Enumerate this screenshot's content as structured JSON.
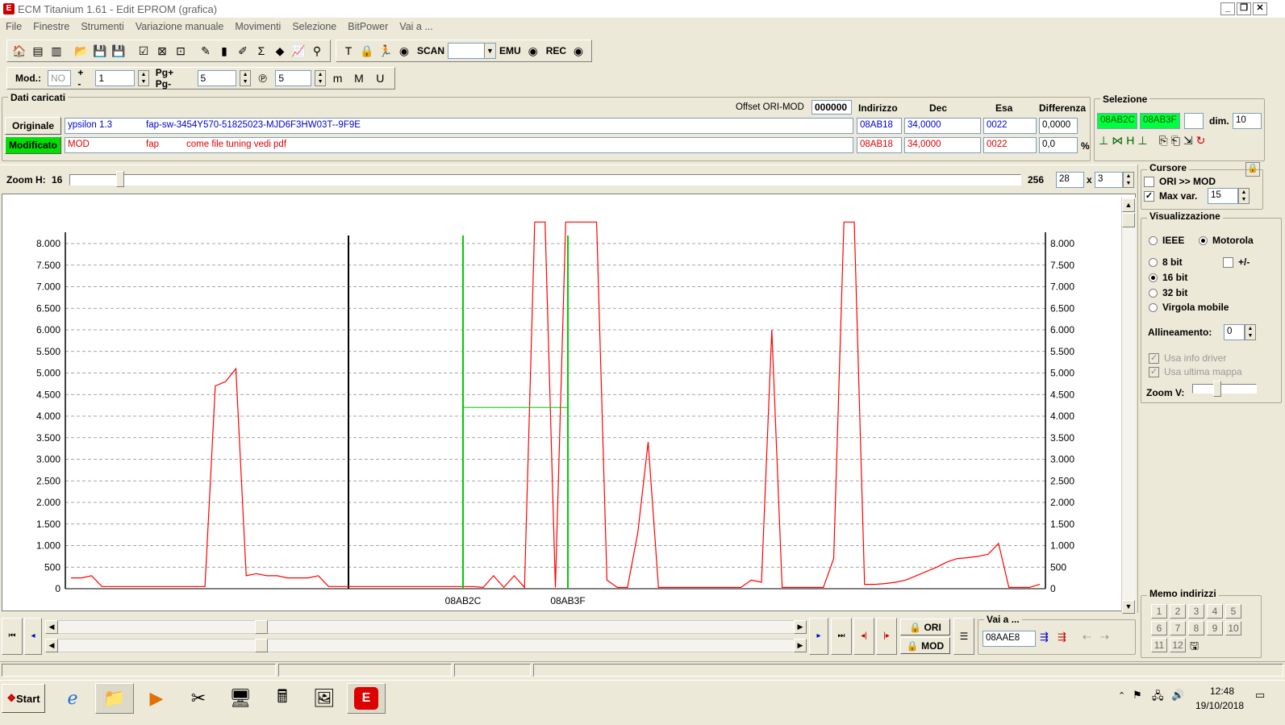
{
  "window": {
    "title": "ECM Titanium 1.61 - Edit EPROM (grafica)"
  },
  "menu": [
    "File",
    "Finestre",
    "Strumenti",
    "Variazione manuale",
    "Movimenti",
    "Selezione",
    "BitPower",
    "Vai a ..."
  ],
  "toolbar1": {
    "scan_label": "SCAN",
    "emu_label": "EMU",
    "rec_label": "REC"
  },
  "toolbar2": {
    "mod_label": "Mod.:",
    "mod_value": "NO",
    "plusminus_label": "+ -",
    "plusminus_value": "1",
    "pg_label": "Pg+ Pg-",
    "pg_value": "5",
    "p_value": "5"
  },
  "dati": {
    "title": "Dati caricati",
    "offset_label": "Offset ORI-MOD",
    "offset_value": "000000",
    "headers": {
      "indirizzo": "Indirizzo",
      "dec": "Dec",
      "esa": "Esa",
      "differenza": "Differenza"
    },
    "originale": {
      "button": "Originale",
      "name": "ypsilon 1.3",
      "desc": "fap-sw-3454Y570-51825023-MJD6F3HW03T--9F9E",
      "indirizzo": "08AB18",
      "dec": "34,0000",
      "esa": "0022",
      "differenza": "0,0000"
    },
    "modificato": {
      "button": "Modificato",
      "name": "MOD",
      "tag": "fap",
      "desc": "come file tuning vedi pdf",
      "indirizzo": "08AB18",
      "dec": "34,0000",
      "esa": "0022",
      "differenza": "0,0",
      "unit": "%"
    }
  },
  "selezione": {
    "title": "Selezione",
    "start": "08AB2C",
    "end": "08AB3F",
    "dim_label": "dim.",
    "dim_value": "10"
  },
  "zoom": {
    "label": "Zoom H:",
    "min": "16",
    "max": "256",
    "w": "28",
    "x": "x",
    "h": "3"
  },
  "cursore": {
    "title": "Cursore",
    "ori_mod": "ORI >> MOD",
    "maxvar": "Max var.",
    "maxvar_value": "15"
  },
  "visualizzazione": {
    "title": "Visualizzazione",
    "ieee": "IEEE",
    "motorola": "Motorola",
    "bit8": "8 bit",
    "plusminus": "+/-",
    "bit16": "16 bit",
    "bit32": "32 bit",
    "virgola": "Virgola mobile",
    "allineamento_label": "Allineamento:",
    "allineamento_value": "0",
    "usa_info": "Usa info driver",
    "usa_ultima": "Usa ultima mappa",
    "zoomv_label": "Zoom V:"
  },
  "memo": {
    "title": "Memo indirizzi",
    "buttons": [
      "1",
      "2",
      "3",
      "4",
      "5",
      "6",
      "7",
      "8",
      "9",
      "10",
      "11",
      "12"
    ]
  },
  "bottom": {
    "ori_label": "ORI",
    "mod_label": "MOD",
    "vai_label": "Vai a ...",
    "vai_value": "08AAE8"
  },
  "taskbar": {
    "start": "Start",
    "time": "12:48",
    "date": "19/10/2018"
  },
  "chart_data": {
    "type": "line",
    "ylim": [
      0,
      8000
    ],
    "yticks": [
      "0",
      "500",
      "1.000",
      "1.500",
      "2.000",
      "2.500",
      "3.000",
      "3.500",
      "4.000",
      "4.500",
      "5.000",
      "5.500",
      "6.000",
      "6.500",
      "7.000",
      "7.500",
      "8.000"
    ],
    "markers": [
      "08AB2C",
      "08AB3F"
    ],
    "colors": {
      "series": "#ff0000",
      "selection": "#00cc00",
      "boundary": "#000000",
      "grid": "#888888"
    },
    "series": [
      {
        "values": [
          250,
          250,
          300,
          50,
          50,
          50,
          50,
          50,
          50,
          50,
          50,
          50,
          50,
          50,
          4700,
          4800,
          5100,
          300,
          350,
          300,
          300,
          250,
          250,
          250,
          300,
          50,
          50,
          50,
          50,
          50,
          50,
          50,
          50,
          50,
          50,
          50,
          50,
          50,
          50,
          50,
          30,
          300,
          30,
          300,
          30,
          8500,
          8500,
          30,
          8500,
          9000,
          8500,
          8500,
          200,
          30,
          30,
          1300,
          3400,
          30,
          30,
          30,
          30,
          30,
          30,
          30,
          30,
          30,
          200,
          150,
          6000,
          30,
          30,
          30,
          30,
          30,
          700,
          8500,
          8500,
          100,
          100,
          120,
          150,
          200,
          300,
          400,
          500,
          620,
          700,
          720,
          750,
          800,
          1050,
          30,
          30,
          30,
          100
        ]
      }
    ]
  }
}
